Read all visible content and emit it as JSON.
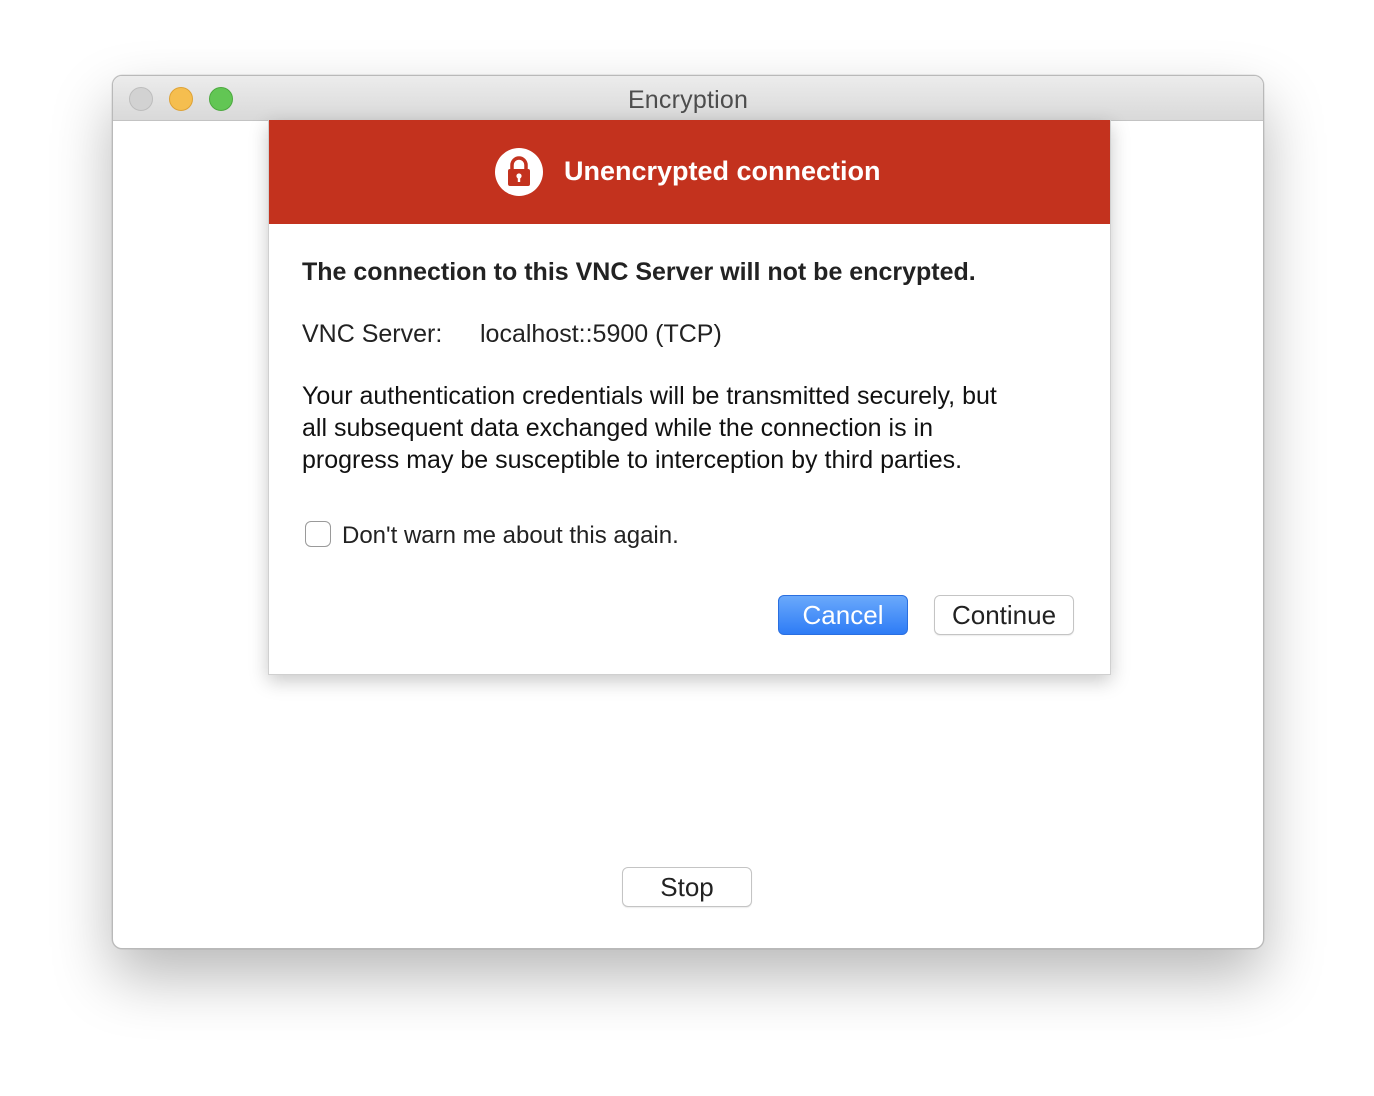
{
  "window": {
    "title": "Encryption"
  },
  "sheet": {
    "banner_title": "Unencrypted connection",
    "heading": "The connection to this VNC Server will not be encrypted.",
    "server_label": "VNC Server:",
    "server_value": "localhost::5900 (TCP)",
    "description_lines": [
      "Your authentication credentials will be transmitted securely, but",
      "all subsequent data exchanged while the connection is in",
      "progress may be susceptible to interception by third parties."
    ],
    "checkbox_label": "Don't warn me about this again.",
    "checkbox_checked": false,
    "cancel_label": "Cancel",
    "continue_label": "Continue"
  },
  "footer": {
    "stop_label": "Stop"
  },
  "icons": {
    "banner_icon": "lock-icon"
  },
  "colors": {
    "banner": "#c3321e",
    "primary_button": "#2e7cf6"
  }
}
